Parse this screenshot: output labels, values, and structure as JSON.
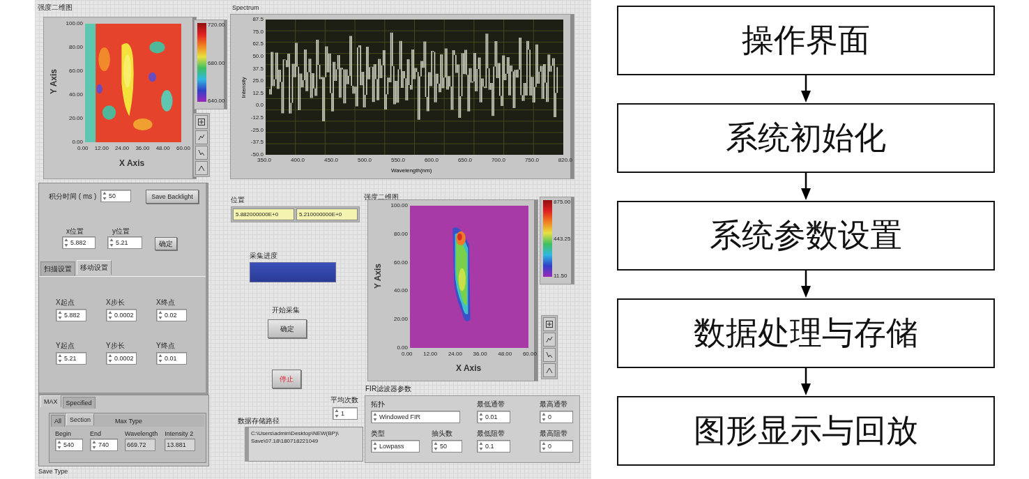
{
  "front_panel": {
    "heatmaps": [
      {
        "label": "强度二维图",
        "x_axis": "X Axis",
        "y_axis": "Y Axis",
        "xticks": [
          "0.00",
          "12.00",
          "24.00",
          "36.00",
          "48.00",
          "60.00"
        ],
        "yticks": [
          "100.00",
          "80.00",
          "60.00",
          "40.00",
          "20.00",
          "0.00"
        ],
        "scale": [
          "720.00",
          "680.00",
          "640.00"
        ]
      },
      {
        "label": "强度二维图",
        "x_axis": "X Axis",
        "y_axis": "Y Axis",
        "xticks": [
          "0.00",
          "12.00",
          "24.00",
          "36.00",
          "48.00",
          "60.00"
        ],
        "yticks": [
          "100.00",
          "80.00",
          "60.00",
          "40.00",
          "20.00",
          "0.00"
        ],
        "scale": [
          "875.00",
          "443.25",
          "11.50"
        ]
      }
    ],
    "spectrum": {
      "label": "Spectrum",
      "xlabel": "Wavelength(nm)",
      "ylabel": "Intensity",
      "xticks": [
        "350.0",
        "400.0",
        "450.0",
        "500.0",
        "550.0",
        "600.0",
        "650.0",
        "700.0",
        "750.0",
        "820.0"
      ],
      "yticks": [
        "87.5",
        "75.0",
        "62.5",
        "50.0",
        "37.5",
        "25.0",
        "12.5",
        "0.0",
        "-12.5",
        "-25.0",
        "-37.5",
        "-50.0"
      ]
    },
    "integration": {
      "label": "积分时间 ( ms )",
      "value": "50"
    },
    "save_backlight": "Save Backlight",
    "x_position": {
      "label": "x位置",
      "value": "5.882"
    },
    "y_position": {
      "label": "y位置",
      "value": "5.21"
    },
    "locate_button": "确定",
    "tabs": [
      {
        "label": "扫描设置",
        "selected": false
      },
      {
        "label": "移动设置",
        "selected": true
      }
    ],
    "params": [
      {
        "label": "X起点",
        "value": "5.882"
      },
      {
        "label": "X步长",
        "value": "0.0002"
      },
      {
        "label": "X终点",
        "value": "0.02"
      },
      {
        "label": "Y起点",
        "value": "5.21"
      },
      {
        "label": "Y步长",
        "value": "0.0002"
      },
      {
        "label": "Y终点",
        "value": "0.01"
      }
    ],
    "save_tabs": [
      {
        "label": "MAX",
        "selected": true
      },
      {
        "label": "Specified",
        "selected": false
      }
    ],
    "section_tabs": [
      {
        "label": "All",
        "selected": false
      },
      {
        "label": "Section",
        "selected": true
      }
    ],
    "max_type": "Max Type",
    "section_fields": [
      {
        "label": "Begin",
        "value": "540",
        "kind": "input"
      },
      {
        "label": "End",
        "value": "740",
        "kind": "input"
      },
      {
        "label": "Wavelength",
        "value": "669.72",
        "kind": "display"
      },
      {
        "label": "Intensity 2",
        "value": "13.881",
        "kind": "display"
      }
    ],
    "save_type": "Save Type",
    "position": {
      "label": "位置",
      "values": [
        "5.882000000E+0",
        "5.210000000E+0"
      ]
    },
    "progress": {
      "label": "采集进度",
      "level": 1
    },
    "start": {
      "label": "开始采集",
      "button": "确定"
    },
    "stop_button": "停止",
    "average": {
      "label": "平均次数",
      "value": "1"
    },
    "path": {
      "label": "数据存储路径",
      "lines": [
        "C:\\Users\\admin\\Desktop\\NEW(BP)\\",
        "Save\\07.18\\180718221049"
      ]
    },
    "filter": {
      "label": "FIR滤波器参数",
      "fields": [
        {
          "label": "拓扑",
          "value": "Windowed FIR"
        },
        {
          "label": "最低通带",
          "value": "0.01"
        },
        {
          "label": "最高通带",
          "value": "0"
        },
        {
          "label": "类型",
          "value": "Lowpass"
        },
        {
          "label": "抽头数",
          "value": "50"
        },
        {
          "label": "最低阻带",
          "value": "0.1"
        },
        {
          "label": "最高阻带",
          "value": "0"
        }
      ]
    }
  },
  "flowchart": {
    "steps": [
      "操作界面",
      "系统初始化",
      "系统参数设置",
      "数据处理与存储",
      "图形显示与回放"
    ]
  }
}
